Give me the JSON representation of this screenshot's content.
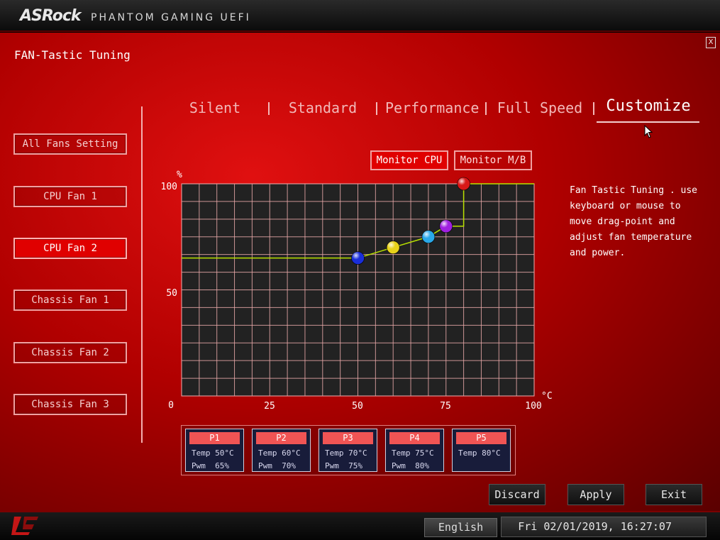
{
  "header": {
    "brand": "ASRock",
    "brand_sub": "PHANTOM GAMING UEFI",
    "close_label": "X"
  },
  "page_title": "FAN-Tastic Tuning",
  "sidebar": {
    "items": [
      {
        "label": "All Fans Setting",
        "active": false
      },
      {
        "label": "CPU Fan 1",
        "active": false
      },
      {
        "label": "CPU Fan 2",
        "active": true
      },
      {
        "label": "Chassis Fan 1",
        "active": false
      },
      {
        "label": "Chassis Fan 2",
        "active": false
      },
      {
        "label": "Chassis Fan 3",
        "active": false
      }
    ]
  },
  "tabs": [
    {
      "label": "Silent",
      "active": false
    },
    {
      "label": "Standard",
      "active": false
    },
    {
      "label": "Performance",
      "active": false
    },
    {
      "label": "Full Speed",
      "active": false
    },
    {
      "label": "Customize",
      "active": true
    }
  ],
  "monitor": {
    "cpu_label": "Monitor CPU",
    "mb_label": "Monitor M/B",
    "selected": "cpu"
  },
  "chart": {
    "y_unit": "%",
    "x_unit": "°C",
    "y_ticks": [
      "100",
      "50",
      "0"
    ],
    "x_ticks": [
      "25",
      "50",
      "75",
      "100"
    ]
  },
  "chart_data": {
    "type": "line",
    "xlim": [
      0,
      100
    ],
    "ylim": [
      0,
      100
    ],
    "grid": true,
    "series": [
      {
        "points": [
          {
            "x": 50,
            "y": 65,
            "color": "#1a2ed8"
          },
          {
            "x": 60,
            "y": 70,
            "color": "#e8d21a"
          },
          {
            "x": 70,
            "y": 75,
            "color": "#2aa8e8"
          },
          {
            "x": 75,
            "y": 80,
            "color": "#a020e0"
          },
          {
            "x": 80,
            "y": 100,
            "color": "#d81818"
          }
        ]
      }
    ],
    "line_color": "#b8e000"
  },
  "help_text": "Fan Tastic Tuning . use\nkeyboard or mouse to\nmove drag-point and\nadjust fan temperature\nand power.",
  "points_panel": [
    {
      "name": "P1",
      "temp": "Temp 50°C",
      "pwm": "Pwm  65%"
    },
    {
      "name": "P2",
      "temp": "Temp 60°C",
      "pwm": "Pwm  70%"
    },
    {
      "name": "P3",
      "temp": "Temp 70°C",
      "pwm": "Pwm  75%"
    },
    {
      "name": "P4",
      "temp": "Temp 75°C",
      "pwm": "Pwm  80%"
    },
    {
      "name": "P5",
      "temp": "Temp 80°C",
      "pwm": ""
    }
  ],
  "actions": {
    "discard": "Discard",
    "apply": "Apply",
    "exit": "Exit"
  },
  "footer": {
    "language": "English",
    "datetime": "Fri 02/01/2019, 16:27:07"
  },
  "colors": {
    "accent": "#e00000",
    "panel_blue": "#181c3a",
    "curve": "#b8e000"
  }
}
